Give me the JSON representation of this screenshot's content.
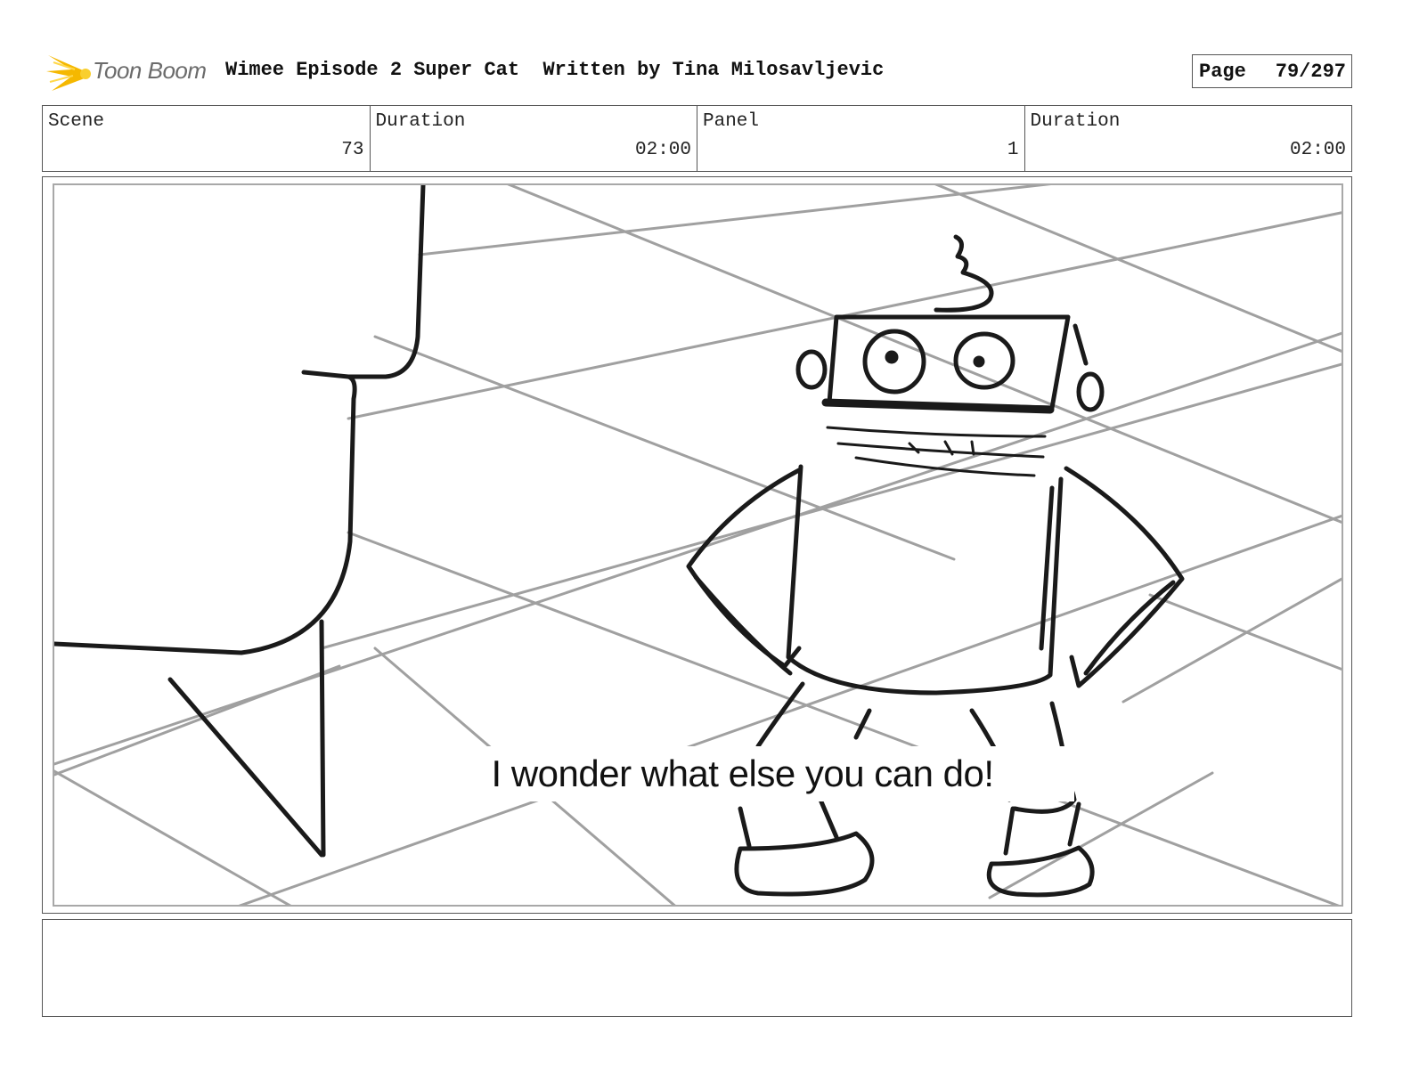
{
  "header": {
    "logo_text": "Toon Boom",
    "title": "Wimee Episode 2 Super Cat  Written by Tina Milosavljevic",
    "page_label": "Page",
    "page_number": "79/297"
  },
  "info": [
    {
      "label": "Scene",
      "value": "73"
    },
    {
      "label": "Duration",
      "value": "02:00"
    },
    {
      "label": "Panel",
      "value": "1"
    },
    {
      "label": "Duration",
      "value": "02:00"
    }
  ],
  "panel": {
    "dialogue": "I wonder what else you can do!"
  },
  "notes": {
    "text": ""
  },
  "colors": {
    "logo_accent": "#f5b800",
    "logo_text": "#6b6b6b",
    "sketch_line": "#1a1a1a",
    "floor_grid": "#a0a0a0",
    "border": "#555555"
  }
}
